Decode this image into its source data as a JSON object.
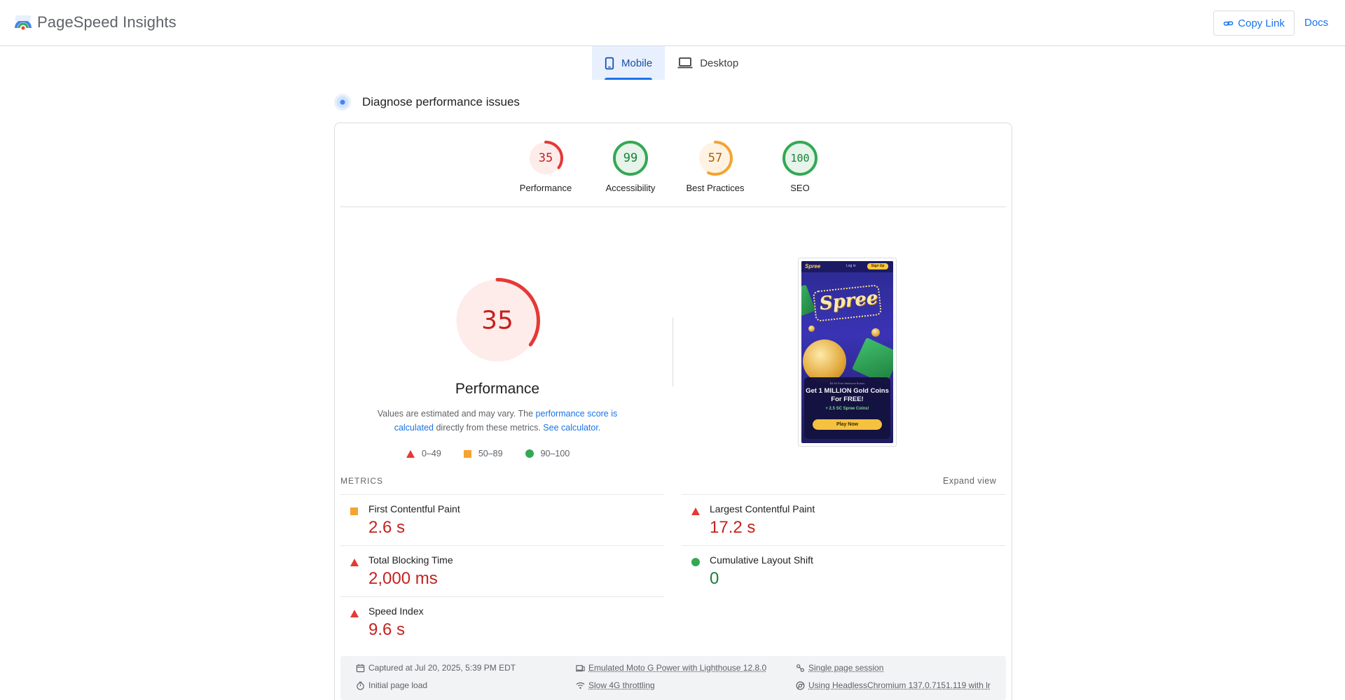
{
  "header": {
    "app_title": "PageSpeed Insights",
    "copy_link_label": "Copy Link",
    "docs_label": "Docs"
  },
  "tabs": [
    {
      "label": "Mobile",
      "active": true,
      "icon": "phone-icon"
    },
    {
      "label": "Desktop",
      "active": false,
      "icon": "laptop-icon"
    }
  ],
  "diagnose_title": "Diagnose performance issues",
  "scores": [
    {
      "value": "35",
      "label": "Performance",
      "color": "#e53935"
    },
    {
      "value": "99",
      "label": "Accessibility",
      "color": "#34a853"
    },
    {
      "value": "57",
      "label": "Best Practices",
      "color": "#f4a431"
    },
    {
      "value": "100",
      "label": "SEO",
      "color": "#34a853"
    }
  ],
  "performance": {
    "score": "35",
    "title": "Performance",
    "desc_before": "Values are estimated and may vary. The ",
    "desc_link1": "performance score is calculated",
    "desc_middle": " directly from these metrics. ",
    "desc_link2": "See calculator."
  },
  "legend": [
    {
      "label": "0–49",
      "icon": "triangle-icon"
    },
    {
      "label": "50–89",
      "icon": "square-icon"
    },
    {
      "label": "90–100",
      "icon": "circle-icon"
    }
  ],
  "screenshot": {
    "brand": "Spree",
    "login": "Log in",
    "signup": "Sign Up",
    "offer_small": "$9.99 Free Welcome Bonus",
    "offer_head": "Get 1 MILLION Gold Coins For FREE!",
    "offer_sub": "+ 2.5 SC Spree Coins!",
    "play": "Play Now"
  },
  "metrics_heading": "METRICS",
  "expand_view": "Expand view",
  "metrics": [
    {
      "name": "First Contentful Paint",
      "value": "2.6 s",
      "status": "average"
    },
    {
      "name": "Largest Contentful Paint",
      "value": "17.2 s",
      "status": "poor"
    },
    {
      "name": "Total Blocking Time",
      "value": "2,000 ms",
      "status": "poor"
    },
    {
      "name": "Cumulative Layout Shift",
      "value": "0",
      "status": "good"
    },
    {
      "name": "Speed Index",
      "value": "9.6 s",
      "status": "poor"
    }
  ],
  "info": {
    "captured": "Captured at Jul 20, 2025, 5:39 PM EDT",
    "device": "Emulated Moto G Power with Lighthouse 12.8.0",
    "session": "Single page session",
    "load": "Initial page load",
    "throttling": "Slow 4G throttling",
    "browser": "Using HeadlessChromium 137.0.7151.119 with lr"
  }
}
